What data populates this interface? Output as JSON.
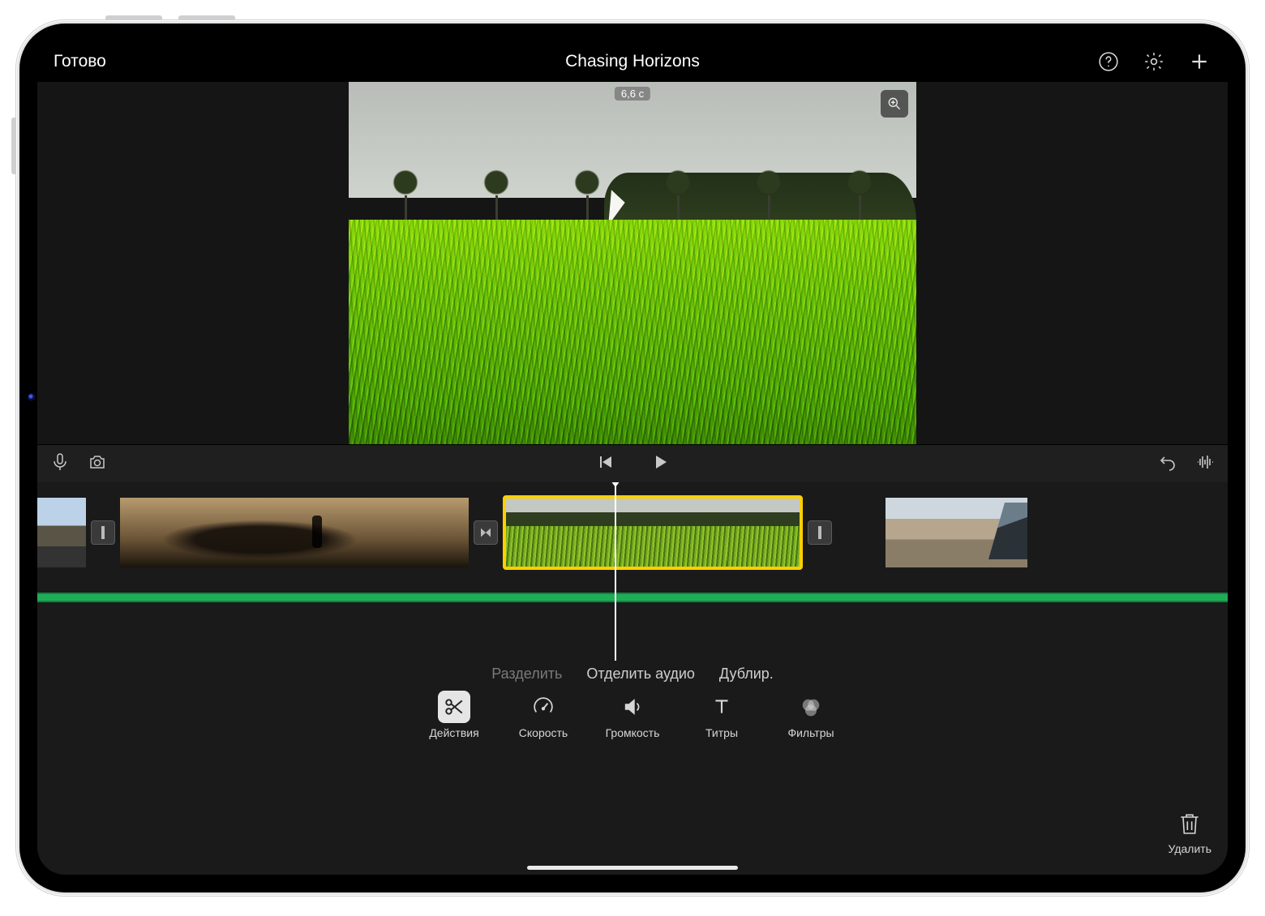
{
  "nav": {
    "done": "Готово",
    "title": "Chasing Horizons"
  },
  "preview": {
    "duration": "6,6 с"
  },
  "edit_tabs": {
    "split": "Разделить",
    "detach_audio": "Отделить аудио",
    "duplicate": "Дублир."
  },
  "tools": {
    "actions": "Действия",
    "speed": "Скорость",
    "volume": "Громкость",
    "titles": "Титры",
    "filters": "Фильтры",
    "delete": "Удалить"
  }
}
